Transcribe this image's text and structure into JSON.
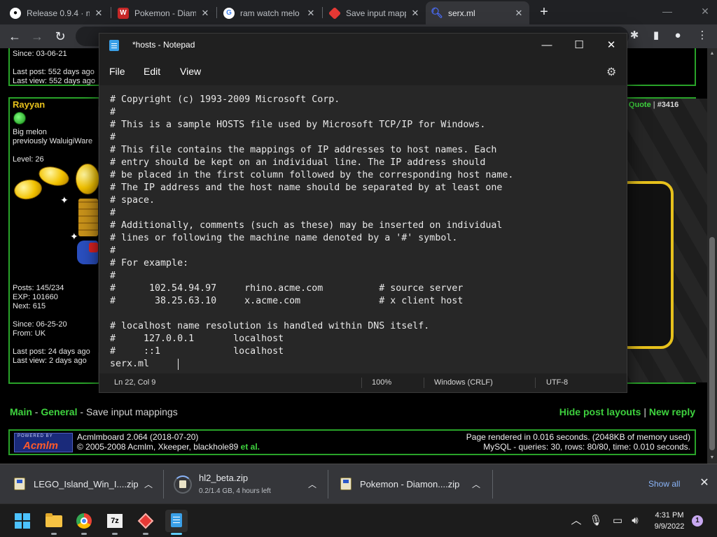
{
  "browser": {
    "tabs": [
      {
        "title": "Release 0.9.4 · n",
        "icon": "github-icon"
      },
      {
        "title": "Pokemon - Diam",
        "icon": "wiki-icon"
      },
      {
        "title": "ram watch melo",
        "icon": "google-icon"
      },
      {
        "title": "Save input mapp",
        "icon": "board-icon"
      },
      {
        "title": "serx.ml",
        "icon": "search-icon"
      }
    ],
    "active_tab_index": 4
  },
  "board": {
    "prev_post": {
      "since": "Since: 03-06-21",
      "last_post": "Last post: 552 days ago",
      "last_view": "Last view: 552 days ago"
    },
    "post": {
      "username": "Rayyan",
      "title_line1": "Big melon",
      "title_line2": "previously WaluigiWare",
      "level": "Level: 26",
      "posts": "Posts: 145/234",
      "exp": "EXP: 101660",
      "next": "Next: 615",
      "since": "Since: 06-25-20",
      "from": "From: UK",
      "last_post": "Last post: 24 days ago",
      "last_view": "Last view: 2 days ago",
      "quote_label": "Quote",
      "post_id": "#3416"
    },
    "breadcrumb": {
      "main": "Main",
      "sep": "-",
      "general": "General",
      "current": "Save input mappings"
    },
    "actions": {
      "hide_layouts": "Hide post layouts",
      "sep": "|",
      "new_reply": "New reply"
    },
    "footer": {
      "powered_by": "POWERED BY",
      "logo_name": "Acmlm",
      "version": "Acmlmboard 2.064 (2018-07-20)",
      "copyright_prefix": "© 2005-2008 Acmlm, Xkeeper, blackhole89",
      "copyright_suffix": "et al.",
      "render_time": "Page rendered in 0.016 seconds. (2048KB of memory used)",
      "mysql": "MySQL - queries: 30, rows: 80/80, time: 0.010 seconds."
    }
  },
  "notepad": {
    "title": "*hosts - Notepad",
    "menu": [
      "File",
      "Edit",
      "View"
    ],
    "content": "# Copyright (c) 1993-2009 Microsoft Corp.\n#\n# This is a sample HOSTS file used by Microsoft TCP/IP for Windows.\n#\n# This file contains the mappings of IP addresses to host names. Each\n# entry should be kept on an individual line. The IP address should\n# be placed in the first column followed by the corresponding host name.\n# The IP address and the host name should be separated by at least one\n# space.\n#\n# Additionally, comments (such as these) may be inserted on individual\n# lines or following the machine name denoted by a '#' symbol.\n#\n# For example:\n#\n#      102.54.94.97     rhino.acme.com          # source server\n#       38.25.63.10     x.acme.com              # x client host\n\n# localhost name resolution is handled within DNS itself.\n#     127.0.0.1       localhost\n#     ::1             localhost\nserx.ml",
    "status": {
      "position": "Ln 22, Col 9",
      "zoom": "100%",
      "line_ending": "Windows (CRLF)",
      "encoding": "UTF-8"
    }
  },
  "downloads": [
    {
      "name": "LEGO_Island_Win_I....zip",
      "sub": ""
    },
    {
      "name": "hl2_beta.zip",
      "sub": "0.2/1.4 GB, 4 hours left"
    },
    {
      "name": "Pokemon - Diamon....zip",
      "sub": ""
    }
  ],
  "downloads_show_all": "Show all",
  "taskbar": {
    "apps": [
      "start-icon",
      "file-explorer-icon",
      "chrome-icon",
      "7zip-icon",
      "emulator-icon",
      "notepad-icon"
    ],
    "time": "4:31 PM",
    "date": "9/9/2022",
    "notification_count": "1"
  },
  "colors": {
    "board_green": "#3fd43f",
    "board_border": "#29a329",
    "chrome_dark": "#202124",
    "chrome_toolbar": "#35363a",
    "notepad_bg": "#272727",
    "link_blue": "#8ab4f8"
  }
}
